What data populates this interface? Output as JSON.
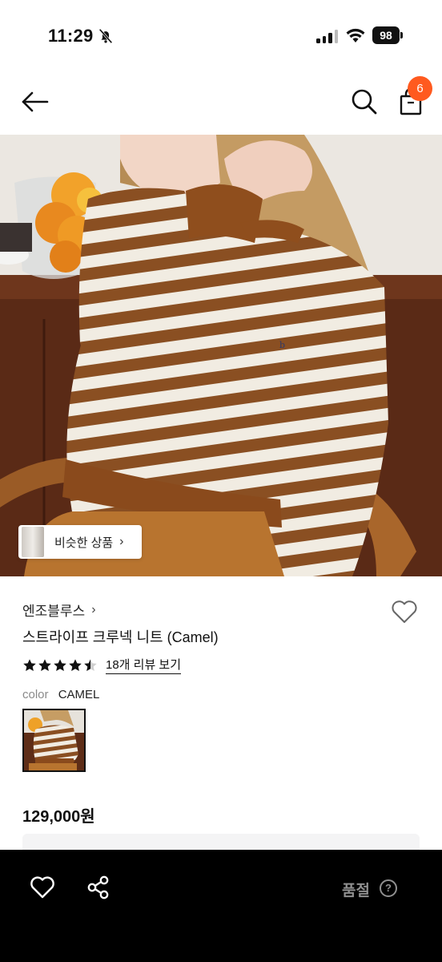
{
  "status_bar": {
    "time": "11:29",
    "battery": "98",
    "icons": [
      "bell-off-icon",
      "signal-icon",
      "wifi-icon",
      "battery-icon"
    ]
  },
  "nav": {
    "icons": [
      "back-arrow-icon",
      "search-icon",
      "shopping-bag-icon"
    ],
    "cart_count": "6"
  },
  "hero": {
    "similar_label": "비슷한 상품",
    "similar_chevron": "›"
  },
  "product": {
    "brand": "엔조블루스",
    "brand_chevron": "›",
    "title": "스트라이프 크루넥 니트 (Camel)",
    "rating": 4.5,
    "review_link": "18개 리뷰 보기",
    "color_key": "color",
    "color_value": "CAMEL",
    "price": "129,000원"
  },
  "bottom_bar": {
    "soldout_label": "품절",
    "help_glyph": "?",
    "icons": [
      "heart-outline-icon",
      "share-icon",
      "help-circle-icon"
    ]
  },
  "colors": {
    "accent_badge": "#ff5a1f",
    "bottom_bar": "#000000",
    "disabled_text": "#8f8f8f",
    "stripe_brown": "#8a4f22",
    "stripe_cream": "#f1ece2"
  }
}
